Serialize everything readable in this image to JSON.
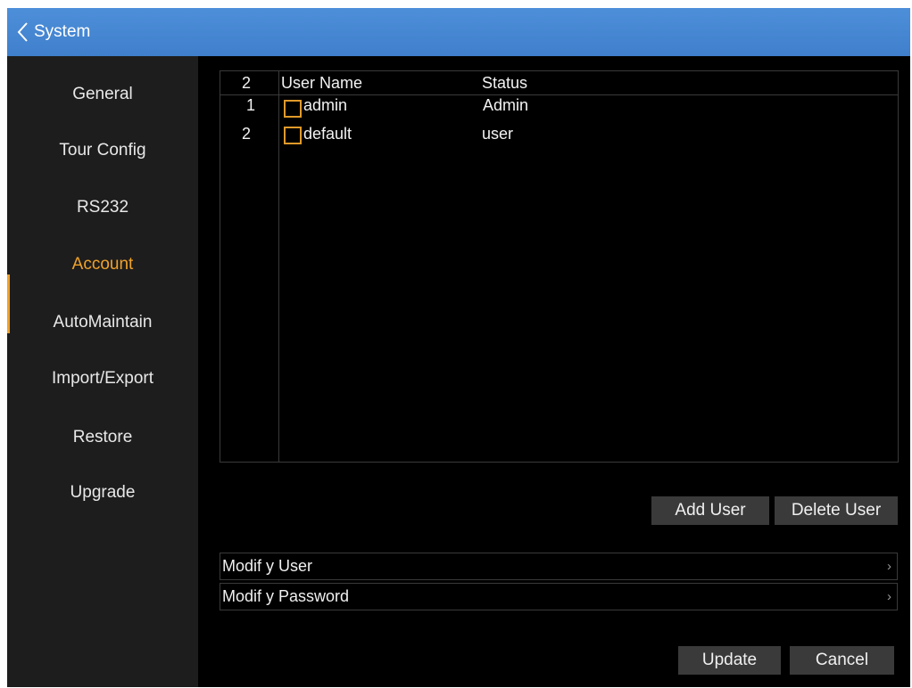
{
  "header": {
    "title": "System",
    "back_icon": "chevron-left-icon"
  },
  "sidebar": {
    "items": [
      {
        "label": "General"
      },
      {
        "label": "Tour Config"
      },
      {
        "label": "RS232"
      },
      {
        "label": "Account",
        "active": true
      },
      {
        "label": "AutoMaintain"
      },
      {
        "label": "Import/Export"
      },
      {
        "label": "Restore"
      },
      {
        "label": "Upgrade"
      }
    ]
  },
  "user_table": {
    "count_header": "2",
    "columns": {
      "name": "User Name",
      "status": "Status"
    },
    "rows": [
      {
        "index": "1",
        "name": "admin",
        "status": "Admin"
      },
      {
        "index": "2",
        "name": "default",
        "status": "user"
      }
    ]
  },
  "actions": {
    "add_user": "Add User",
    "delete_user": "Delete User"
  },
  "links": {
    "modify_user": "Modif y User",
    "modify_password": "Modif y Password",
    "chevron": "›"
  },
  "footer": {
    "update": "Update",
    "cancel": "Cancel"
  },
  "colors": {
    "accent": "#f0a22a",
    "titlebar": "#4686d2",
    "sidebar": "#1d1d1d",
    "button": "#3a3a3a"
  }
}
